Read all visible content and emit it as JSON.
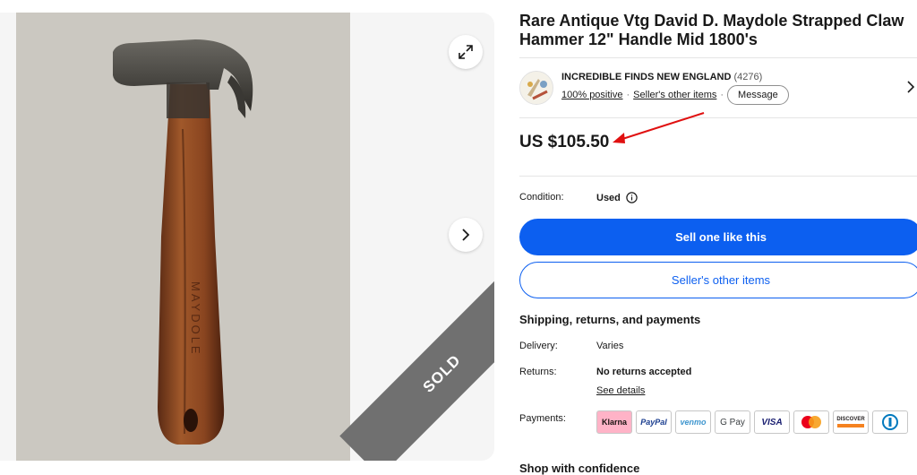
{
  "gallery": {
    "sold_label": "SOLD",
    "photo_stamp": "MAYDOLE"
  },
  "listing": {
    "title": "Rare Antique Vtg David D. Maydole Strapped Claw Hammer 12\" Handle Mid 1800's",
    "price": "US $105.50",
    "condition_label": "Condition:",
    "condition_value": "Used"
  },
  "seller": {
    "name": "INCREDIBLE FINDS NEW ENGLAND",
    "feedback_count": "(4276)",
    "positive": "100% positive",
    "dot": "·",
    "other_items_link": "Seller's other items",
    "message_button": "Message"
  },
  "actions": {
    "primary": "Sell one like this",
    "secondary": "Seller's other items"
  },
  "shipping": {
    "section_title": "Shipping, returns, and payments",
    "delivery_label": "Delivery:",
    "delivery_value": "Varies",
    "returns_label": "Returns:",
    "returns_value": "No returns accepted",
    "see_details": "See details",
    "payments_label": "Payments:",
    "methods": [
      "Klarna",
      "PayPal",
      "venmo",
      "G Pay",
      "VISA",
      "Mastercard",
      "DISCOVER",
      "Diners Club"
    ]
  },
  "confidence": {
    "section_title": "Shop with confidence"
  },
  "icons": {
    "expand": "expand-icon",
    "next": "chevron-right-icon",
    "info": "info-icon",
    "seller_chevron": "chevron-right-icon"
  },
  "colors": {
    "primary_blue": "#0c5ff0",
    "annotation_red": "#e01010",
    "sold_ribbon": "#707070"
  }
}
